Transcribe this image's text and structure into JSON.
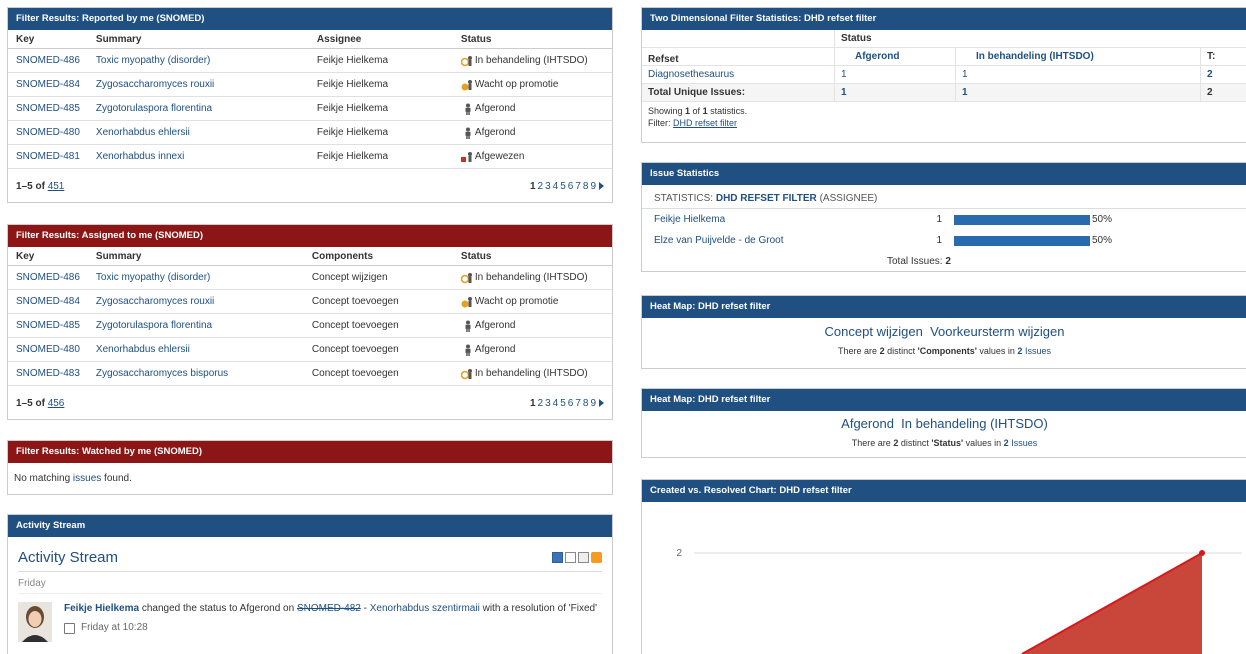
{
  "reported": {
    "title": "Filter Results: Reported by me (SNOMED)",
    "columns": [
      "Key",
      "Summary",
      "Assignee",
      "Status"
    ],
    "rows": [
      {
        "key": "SNOMED-486",
        "summary": "Toxic myopathy (disorder)",
        "assignee": "Feikje Hielkema",
        "status": "In behandeling (IHTSDO)",
        "status_icon": "in-progress-icon"
      },
      {
        "key": "SNOMED-484",
        "summary": "Zygosaccharomyces rouxii",
        "assignee": "Feikje Hielkema",
        "status": "Wacht op promotie",
        "status_icon": "waiting-icon"
      },
      {
        "key": "SNOMED-485",
        "summary": "Zygotorulaspora florentina",
        "assignee": "Feikje Hielkema",
        "status": "Afgerond",
        "status_icon": "done-icon"
      },
      {
        "key": "SNOMED-480",
        "summary": "Xenorhabdus ehlersii",
        "assignee": "Feikje Hielkema",
        "status": "Afgerond",
        "status_icon": "done-icon"
      },
      {
        "key": "SNOMED-481",
        "summary": "Xenorhabdus innexi",
        "assignee": "Feikje Hielkema",
        "status": "Afgewezen",
        "status_icon": "rejected-icon"
      }
    ],
    "range": "1–5 of",
    "total": "451",
    "pages": [
      "1",
      "2",
      "3",
      "4",
      "5",
      "6",
      "7",
      "8",
      "9"
    ]
  },
  "assigned": {
    "title": "Filter Results: Assigned to me (SNOMED)",
    "columns": [
      "Key",
      "Summary",
      "Components",
      "Status"
    ],
    "rows": [
      {
        "key": "SNOMED-486",
        "summary": "Toxic myopathy (disorder)",
        "component": "Concept wijzigen",
        "status": "In behandeling (IHTSDO)",
        "status_icon": "in-progress-icon"
      },
      {
        "key": "SNOMED-484",
        "summary": "Zygosaccharomyces rouxii",
        "component": "Concept toevoegen",
        "status": "Wacht op promotie",
        "status_icon": "waiting-icon"
      },
      {
        "key": "SNOMED-485",
        "summary": "Zygotorulaspora florentina",
        "component": "Concept toevoegen",
        "status": "Afgerond",
        "status_icon": "done-icon"
      },
      {
        "key": "SNOMED-480",
        "summary": "Xenorhabdus ehlersii",
        "component": "Concept toevoegen",
        "status": "Afgerond",
        "status_icon": "done-icon"
      },
      {
        "key": "SNOMED-483",
        "summary": "Zygosaccharomyces bisporus",
        "component": "Concept toevoegen",
        "status": "In behandeling (IHTSDO)",
        "status_icon": "in-progress-icon"
      }
    ],
    "range": "1–5 of",
    "total": "456",
    "pages": [
      "1",
      "2",
      "3",
      "4",
      "5",
      "6",
      "7",
      "8",
      "9"
    ]
  },
  "watched": {
    "title": "Filter Results: Watched by me (SNOMED)",
    "text_before": "No matching ",
    "link": "issues",
    "text_after": " found."
  },
  "activity": {
    "header": "Activity Stream",
    "title": "Activity Stream",
    "day": "Friday",
    "user": "Feikje Hielkema",
    "action": " changed the status to Afgerond on ",
    "issue_key": "SNOMED-482",
    "separator": " - ",
    "issue_summary": "Xenorhabdus szentirmaii",
    "resolution": " with a resolution of 'Fixed'",
    "time": "Friday at 10:28"
  },
  "twodim": {
    "title": "Two Dimensional Filter Statistics: DHD refset filter",
    "status_header": "Status",
    "row_header": "Refset",
    "col1": "Afgerond",
    "col2": "In behandeling (IHTSDO)",
    "col3": "T:",
    "row_label": "Diagnosethesaurus",
    "row_v1": "1",
    "row_v2": "1",
    "row_v3": "2",
    "total_label": "Total Unique Issues:",
    "total_v1": "1",
    "total_v2": "1",
    "total_v3": "2",
    "showing_pre": "Showing ",
    "showing_n": "1",
    "showing_mid": " of ",
    "showing_m": "1",
    "showing_post": " statistics.",
    "filter_label": "Filter: ",
    "filter_link": "DHD refset filter"
  },
  "issuestats": {
    "title": "Issue Statistics",
    "stat_prefix": "STATISTICS: ",
    "stat_filter": "DHD REFSET FILTER",
    "stat_suffix": " (ASSIGNEE)",
    "rows": [
      {
        "name": "Feikje Hielkema",
        "count": "1",
        "percent": "50%",
        "fraction": 0.5
      },
      {
        "name": "Elze van Puijvelde - de Groot",
        "count": "1",
        "percent": "50%",
        "fraction": 0.5
      }
    ],
    "total_label": "Total Issues: ",
    "total": "2"
  },
  "heat1": {
    "title": "Heat Map: DHD refset filter",
    "items": [
      "Concept wijzigen",
      "Voorkeursterm wijzigen"
    ],
    "t1": "There are ",
    "n": "2",
    "t2": " distinct ",
    "field": "'Components'",
    "t3": " values in ",
    "n2": "2",
    "link": "Issues"
  },
  "heat2": {
    "title": "Heat Map: DHD refset filter",
    "items": [
      "Afgerond",
      "In behandeling (IHTSDO)"
    ],
    "t1": "There are ",
    "n": "2",
    "t2": " distinct ",
    "field": "'Status'",
    "t3": " values in ",
    "n2": "2",
    "link": "Issues"
  },
  "chart": {
    "title": "Created vs. Resolved Chart: DHD refset filter"
  },
  "chart_data": {
    "type": "area",
    "y_ticks": [
      "2"
    ],
    "series": [
      {
        "values_visible": [
          2
        ]
      }
    ],
    "colors": {
      "area": "#c8473a",
      "line": "#d7191c"
    }
  },
  "colors": {
    "blue_header": "#205081",
    "red_header": "#8c1616",
    "link": "#205081",
    "bar": "#2a6bb0"
  }
}
